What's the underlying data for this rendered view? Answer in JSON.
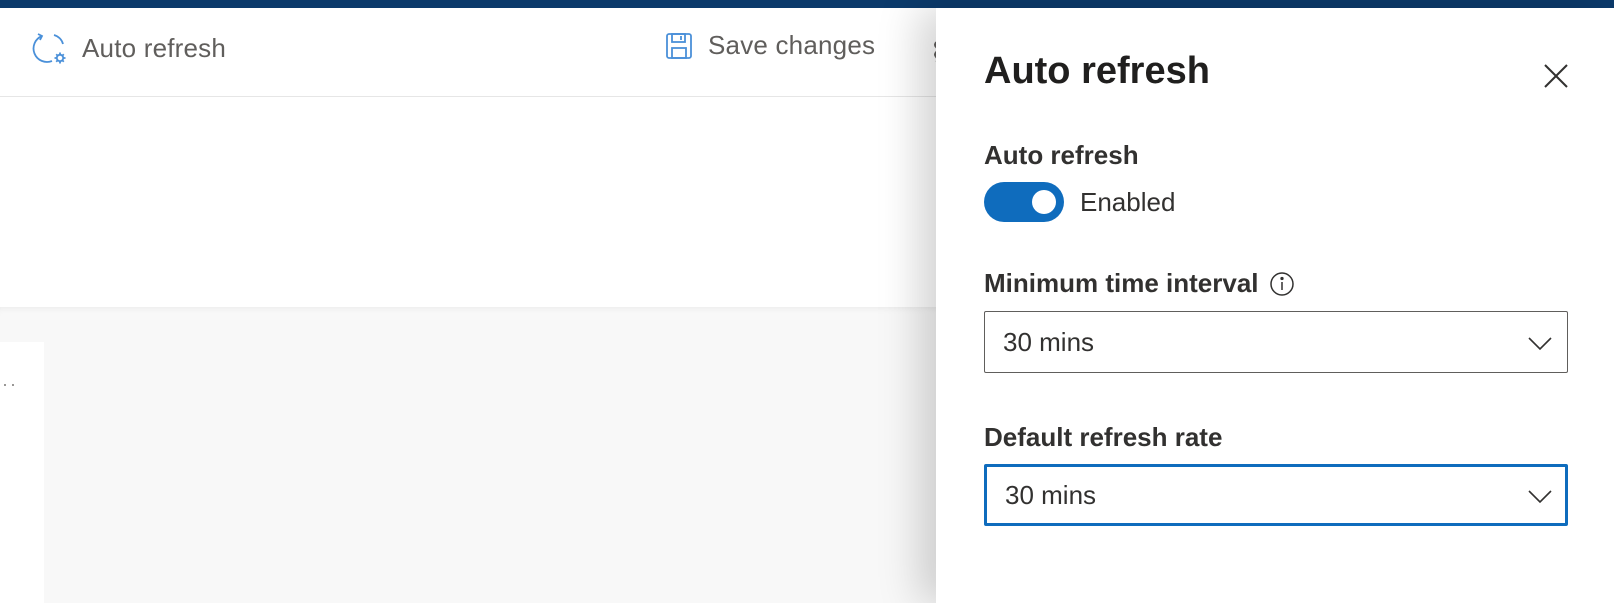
{
  "toolbar": {
    "auto_refresh_label": "Auto refresh",
    "save_changes_label": "Save changes",
    "auto_refresh_icon": "refresh-gear-icon",
    "save_icon": "save-icon"
  },
  "panel": {
    "title": "Auto refresh",
    "close_icon": "close-icon",
    "auto_refresh": {
      "label": "Auto refresh",
      "state_text": "Enabled",
      "enabled": true
    },
    "min_interval": {
      "label": "Minimum time interval",
      "info_icon": "info-icon",
      "value": "30 mins"
    },
    "default_rate": {
      "label": "Default refresh rate",
      "value": "30 mins",
      "focused": true
    }
  },
  "colors": {
    "top_bar": "#0b3a6b",
    "accent": "#0f6cbd",
    "icon_blue": "#4a90d9"
  }
}
